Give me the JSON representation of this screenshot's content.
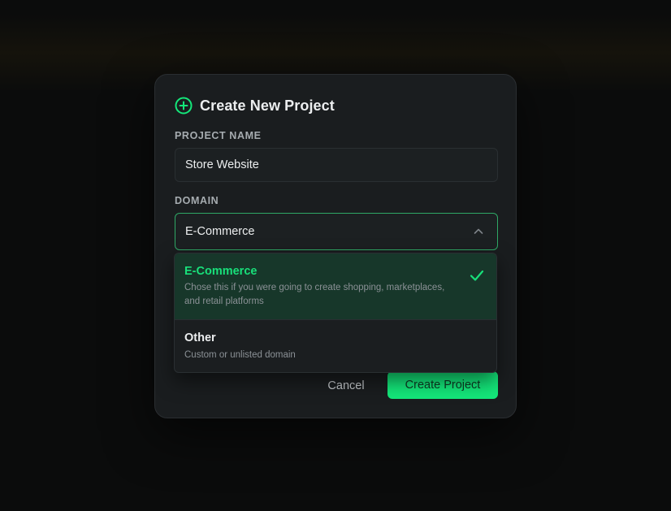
{
  "dialog": {
    "title": "Create New Project",
    "project_name_label": "PROJECT NAME",
    "project_name_value": "Store Website",
    "domain_label": "DOMAIN",
    "domain_value": "E-Commerce"
  },
  "dropdown": {
    "options": [
      {
        "title": "E-Commerce",
        "description": "Chose this if you were going to create shopping, marketplaces, and retail platforms",
        "selected": true
      },
      {
        "title": "Other",
        "description": "Custom or unlisted domain",
        "selected": false
      }
    ]
  },
  "footer": {
    "cancel_label": "Cancel",
    "create_label": "Create Project"
  },
  "colors": {
    "accent": "#14e77a",
    "selected_bg": "#17372a",
    "modal_bg": "#1a1d1f"
  },
  "icons": {
    "title_icon": "plus-circle-icon",
    "select_icon": "chevron-up-icon",
    "selected_icon": "check-icon"
  }
}
